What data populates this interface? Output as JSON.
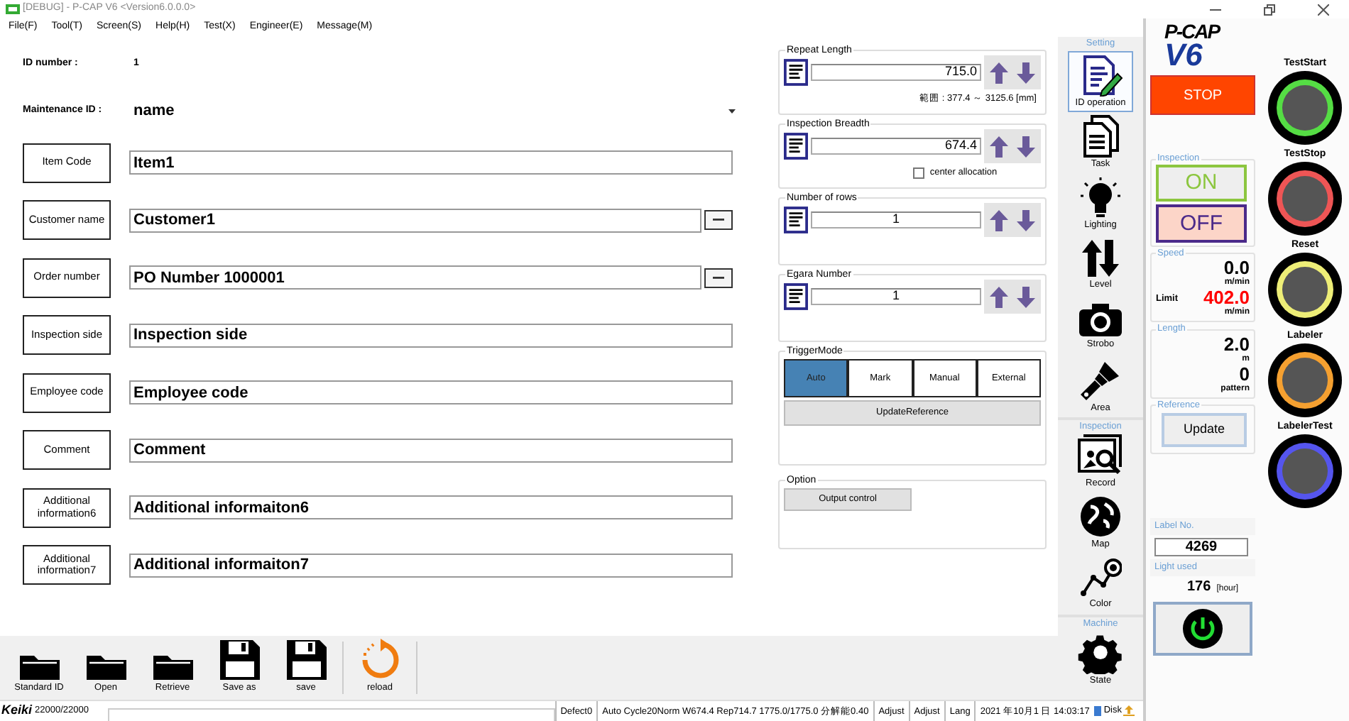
{
  "window": {
    "title": "[DEBUG] - P-CAP V6  <Version6.0.0.0>"
  },
  "menu": [
    "File(F)",
    "Tool(T)",
    "Screen(S)",
    "Help(H)",
    "Test(X)",
    "Engineer(E)",
    "Message(M)"
  ],
  "id_number": {
    "label": "ID number :",
    "value": "1"
  },
  "maintenance_id": {
    "label": "Maintenance ID :",
    "value": "name"
  },
  "fields": [
    {
      "label": "Item Code",
      "value": "Item1",
      "browse": false
    },
    {
      "label": "Customer name",
      "value": "Customer1",
      "browse": true
    },
    {
      "label": "Order number",
      "value": "PO Number 1000001",
      "browse": true
    },
    {
      "label": "Inspection side",
      "value": "Inspection side",
      "browse": false
    },
    {
      "label": "Employee code",
      "value": "Employee code",
      "browse": false
    },
    {
      "label": "Comment",
      "value": "Comment",
      "browse": false
    },
    {
      "label": "Additional information6",
      "value": "Additional informaiton6",
      "browse": false
    },
    {
      "label": "Additional information7",
      "value": "Additional informaiton7",
      "browse": false
    }
  ],
  "settings": [
    {
      "title": "Repeat Length",
      "value": "715.0",
      "kind": "decimal",
      "note": "範囲 : 377.4 ～ 3125.6 [mm]"
    },
    {
      "title": "Inspection Breadth",
      "value": "674.4",
      "kind": "decimal",
      "checkbox": {
        "label": "center allocation",
        "checked": false
      }
    },
    {
      "title": "Number of rows",
      "value": "1",
      "kind": "integer"
    },
    {
      "title": "Egara Number",
      "value": "1",
      "kind": "integer"
    }
  ],
  "trigger_mode": {
    "title": "TriggerMode",
    "modes": [
      {
        "label": "Auto",
        "selected": true
      },
      {
        "label": "Mark",
        "selected": false
      },
      {
        "label": "Manual",
        "selected": false
      },
      {
        "label": "External",
        "selected": false
      }
    ],
    "update_button": "UpdateReference"
  },
  "option": {
    "title": "Option",
    "button": "Output control"
  },
  "nav": [
    {
      "header": "Setting",
      "items": [
        {
          "label": "ID operation",
          "kind": "document-pen",
          "selected": true
        },
        {
          "label": "Task",
          "kind": "pages",
          "selected": false
        },
        {
          "label": "Lighting",
          "kind": "bulb",
          "selected": false
        },
        {
          "label": "Level",
          "kind": "arrows",
          "selected": false
        },
        {
          "label": "Strobo",
          "kind": "camera",
          "selected": false
        },
        {
          "label": "Area",
          "kind": "brush",
          "selected": false
        }
      ]
    },
    {
      "header": "Inspection",
      "items": [
        {
          "label": "Record",
          "kind": "photo-search",
          "selected": false
        },
        {
          "label": "Map",
          "kind": "globe",
          "selected": false
        },
        {
          "label": "Color",
          "kind": "chart",
          "selected": false
        }
      ]
    },
    {
      "header": "Machine",
      "items": [
        {
          "label": "State",
          "kind": "gear",
          "selected": false
        }
      ]
    }
  ],
  "toolbar": [
    {
      "label": "Standard ID",
      "kind": "folder"
    },
    {
      "label": "Open",
      "kind": "folder"
    },
    {
      "label": "Retrieve",
      "kind": "folder"
    },
    {
      "label": "Save as",
      "kind": "floppy"
    },
    {
      "label": "save",
      "kind": "floppy"
    },
    {
      "label": "reload",
      "kind": "reload"
    }
  ],
  "status_bar": {
    "logo": "Keiki",
    "count": "22000/22000",
    "segments": [
      "Defect0",
      "Auto  Cycle20Norm  W674.4  Rep714.7  1775.0/1775.0  分解能0.40",
      "Adjust",
      "Adjust",
      "Lang",
      "2021 年10月1 日 14:03:17"
    ],
    "disk": "Disk"
  },
  "control_panel": {
    "logo_top": "P-CAP",
    "logo_bottom": "V6",
    "stop_button": "STOP",
    "inspection": {
      "title": "Inspection",
      "on": "ON",
      "off": "OFF"
    },
    "speed": {
      "title": "Speed",
      "value": "0.0",
      "unit": "m/min",
      "limit_label": "Limit",
      "limit": "402.0",
      "limit_unit": "m/min"
    },
    "length": {
      "title": "Length",
      "value": "2.0",
      "unit": "m",
      "count": "0",
      "count_unit": "pattern"
    },
    "reference": {
      "title": "Reference",
      "button": "Update"
    },
    "label_no": {
      "title": "Label No.",
      "value": "4269"
    },
    "light_used": {
      "title": "Light used",
      "value": "176",
      "unit": "[hour]"
    },
    "lamps": [
      {
        "label": "TestStart",
        "color": "#55dd44"
      },
      {
        "label": "TestStop",
        "color": "#ee5555"
      },
      {
        "label": "Reset",
        "color": "#eeee77"
      },
      {
        "label": "Labeler",
        "color": "#f5a030"
      },
      {
        "label": "LabelerTest",
        "color": "#5555ee"
      }
    ]
  }
}
